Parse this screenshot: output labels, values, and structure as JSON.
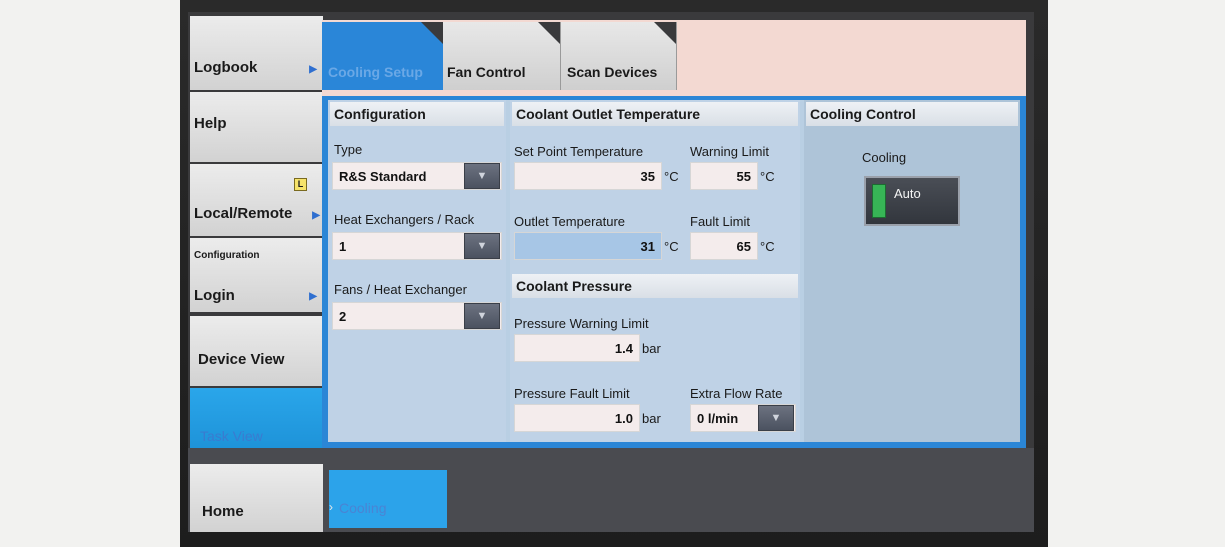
{
  "nav": {
    "logbook": "Logbook",
    "help": "Help",
    "local_remote": "Local/Remote",
    "local_badge": "L",
    "configuration_small": "Configuration",
    "login": "Login",
    "device_view": "Device View",
    "task_view": "Task View",
    "home": "Home"
  },
  "tabs": [
    "Cooling Setup",
    "Fan Control",
    "Scan Devices"
  ],
  "configuration": {
    "header": "Configuration",
    "type_label": "Type",
    "type_value": "R&S Standard",
    "hx_label": "Heat Exchangers / Rack",
    "hx_value": "1",
    "fans_label": "Fans / Heat Exchanger",
    "fans_value": "2"
  },
  "coolant_outlet": {
    "header": "Coolant Outlet Temperature",
    "setpoint_label": "Set Point Temperature",
    "setpoint_value": "35",
    "warning_label": "Warning Limit",
    "warning_value": "55",
    "outlet_label": "Outlet Temperature",
    "outlet_value": "31",
    "fault_label": "Fault Limit",
    "fault_value": "65",
    "unit": "°C"
  },
  "coolant_pressure": {
    "header": "Coolant Pressure",
    "warning_label": "Pressure Warning Limit",
    "warning_value": "1.4",
    "fault_label": "Pressure Fault Limit",
    "fault_value": "1.0",
    "unit": "bar",
    "flow_label": "Extra Flow Rate",
    "flow_value": "0 l/min"
  },
  "cooling_control": {
    "header": "Cooling Control",
    "cooling_label": "Cooling",
    "mode": "Auto"
  },
  "breadcrumb": "Cooling"
}
